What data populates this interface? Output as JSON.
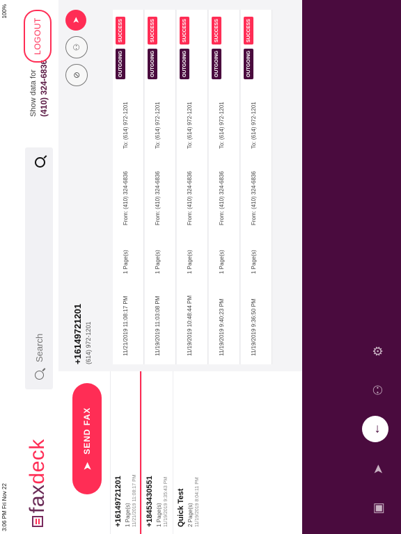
{
  "status_bar": {
    "time": "3:06 PM  Fri Nov 22",
    "battery": "100%"
  },
  "app": {
    "logo_prefix": "fax",
    "logo_suffix": "deck"
  },
  "search": {
    "placeholder": "Search"
  },
  "header": {
    "show_data_label": "Show data for",
    "show_data_number": "(410) 324-6836",
    "logout_label": "LOGOUT"
  },
  "send_fax_label": "SEND FAX",
  "transmissions": [
    {
      "title": "+16149721201",
      "pages": "1 Page(s)",
      "date": "11/21/2019 11:08:17 PM"
    },
    {
      "title": "+18453430551",
      "pages": "1 Page(s)",
      "date": "11/19/2019 9:35:43 PM"
    },
    {
      "title": "Quick Test",
      "pages": "2 Page(s)",
      "date": "11/19/2019 8:04:11 PM"
    }
  ],
  "detail": {
    "title": "+16149721201",
    "subtitle": "(614) 972-1201",
    "rows": [
      {
        "datetime": "11/21/2019 11:08:17 PM",
        "pages": "1 Page(s)",
        "from": "From: (410) 324-6836",
        "to": "To: (614) 972-1201",
        "direction": "OUTGOING",
        "status": "SUCCESS"
      },
      {
        "datetime": "11/19/2019 11:03:08 PM",
        "pages": "1 Page(s)",
        "from": "From: (410) 324-6836",
        "to": "To: (614) 972-1201",
        "direction": "OUTGOING",
        "status": "SUCCESS"
      },
      {
        "datetime": "11/19/2019 10:48:44 PM",
        "pages": "1 Page(s)",
        "from": "From: (410) 324-6836",
        "to": "To: (614) 972-1201",
        "direction": "OUTGOING",
        "status": "SUCCESS"
      },
      {
        "datetime": "11/19/2019 9:40:23 PM",
        "pages": "1 Page(s)",
        "from": "From: (410) 324-6836",
        "to": "To: (614) 972-1201",
        "direction": "OUTGOING",
        "status": "SUCCESS"
      },
      {
        "datetime": "11/19/2019 9:36:50 PM",
        "pages": "1 Page(s)",
        "from": "From: (410) 324-6836",
        "to": "To: (614) 972-1201",
        "direction": "OUTGOING",
        "status": "SUCCESS"
      }
    ]
  },
  "nav_icons": [
    "inbox-icon",
    "send-icon",
    "logout-arrow-icon",
    "contacts-icon",
    "settings-gear-icon"
  ],
  "colors": {
    "brand": "#4a0b3e",
    "accent": "#ff2d55"
  }
}
